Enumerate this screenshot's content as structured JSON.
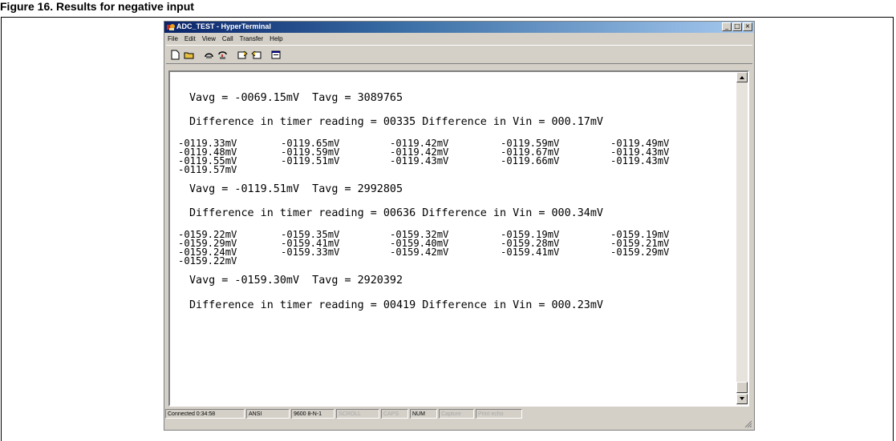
{
  "figure_title": "Figure 16. Results for negative input",
  "window": {
    "title": "ADC_TEST - HyperTerminal",
    "menu": [
      "File",
      "Edit",
      "View",
      "Call",
      "Transfer",
      "Help"
    ],
    "toolbar_icons": [
      "new-connection-icon",
      "open-icon",
      "connect-icon",
      "disconnect-icon",
      "send-icon",
      "receive-icon",
      "properties-icon"
    ]
  },
  "terminal": {
    "blocks": [
      {
        "avg_line": "Vavg = -0069.15mV  Tavg = 3089765",
        "diff_line": "Difference in timer reading = 00335 Difference in Vin = 000.17mV",
        "rows": []
      },
      {
        "rows": [
          [
            "-0119.33mV",
            "-0119.65mV",
            "-0119.42mV",
            "-0119.59mV",
            "-0119.49mV"
          ],
          [
            "-0119.48mV",
            "-0119.59mV",
            "-0119.42mV",
            "-0119.67mV",
            "-0119.43mV"
          ],
          [
            "-0119.55mV",
            "-0119.51mV",
            "-0119.43mV",
            "-0119.66mV",
            "-0119.43mV"
          ],
          [
            "-0119.57mV"
          ]
        ],
        "avg_line": "Vavg = -0119.51mV  Tavg = 2992805",
        "diff_line": "Difference in timer reading = 00636 Difference in Vin = 000.34mV"
      },
      {
        "rows": [
          [
            "-0159.22mV",
            "-0159.35mV",
            "-0159.32mV",
            "-0159.19mV",
            "-0159.19mV"
          ],
          [
            "-0159.29mV",
            "-0159.41mV",
            "-0159.40mV",
            "-0159.28mV",
            "-0159.21mV"
          ],
          [
            "-0159.24mV",
            "-0159.33mV",
            "-0159.42mV",
            "-0159.41mV",
            "-0159.29mV"
          ],
          [
            "-0159.22mV"
          ]
        ],
        "avg_line": "Vavg = -0159.30mV  Tavg = 2920392",
        "diff_line": "Difference in timer reading = 00419 Difference in Vin = 000.23mV"
      }
    ]
  },
  "status_bar": [
    {
      "text": "Connected 0:34:58",
      "dim": false
    },
    {
      "text": "ANSI",
      "dim": false
    },
    {
      "text": "9600 8-N-1",
      "dim": false
    },
    {
      "text": "SCROLL",
      "dim": true
    },
    {
      "text": "CAPS",
      "dim": true
    },
    {
      "text": "NUM",
      "dim": false
    },
    {
      "text": "Capture",
      "dim": true
    },
    {
      "text": "Print echo",
      "dim": true
    }
  ]
}
